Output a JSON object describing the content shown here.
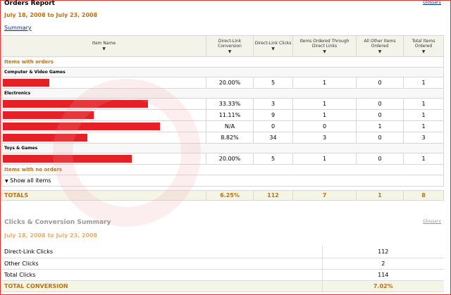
{
  "header": {
    "title": "Orders Report",
    "glossary": "Glossary",
    "date_range": "July 18, 2008 to July 23, 2008",
    "summary_link": "Summary"
  },
  "table": {
    "columns": [
      "Item Name",
      "Direct-Link Conversion",
      "Direct-Link Clicks",
      "Items Ordered Through Direct Links",
      "All Other Items Ordered",
      "Total Items Ordered"
    ],
    "sort_icon": "triangle-down-icon",
    "section_with_orders": "Items with orders",
    "categories": [
      {
        "name": "Computer & Video Games",
        "rows": [
          {
            "bar": 0.23,
            "conversion": "20.00%",
            "clicks": "5",
            "through": "1",
            "other": "0",
            "total": "1"
          }
        ]
      },
      {
        "name": "Electronics",
        "rows": [
          {
            "bar": 0.72,
            "conversion": "33.33%",
            "clicks": "3",
            "through": "1",
            "other": "0",
            "total": "1"
          },
          {
            "bar": 0.45,
            "conversion": "11.11%",
            "clicks": "9",
            "through": "1",
            "other": "0",
            "total": "1"
          },
          {
            "bar": 0.78,
            "conversion": "N/A",
            "clicks": "0",
            "through": "0",
            "other": "1",
            "total": "1"
          },
          {
            "bar": 0.42,
            "conversion": "8.82%",
            "clicks": "34",
            "through": "3",
            "other": "0",
            "total": "3"
          }
        ]
      },
      {
        "name": "Toys & Games",
        "rows": [
          {
            "bar": 0.64,
            "conversion": "20.00%",
            "clicks": "5",
            "through": "1",
            "other": "0",
            "total": "1"
          }
        ]
      }
    ],
    "section_no_orders": "Items with no orders",
    "show_all": "Show all items",
    "totals": {
      "label": "TOTALS",
      "conversion": "6.25%",
      "clicks": "112",
      "through": "7",
      "other": "1",
      "total": "8"
    }
  },
  "summary": {
    "title": "Clicks & Conversion Summary",
    "glossary": "Glossary",
    "date_range": "July 18, 2008 to July 23, 2008",
    "rows": [
      {
        "label": "Direct-Link Clicks",
        "value": "112"
      },
      {
        "label": "Other Clicks",
        "value": "2"
      },
      {
        "label": "Total Clicks",
        "value": "114"
      }
    ],
    "total": {
      "label": "TOTAL CONVERSION",
      "value": "7.02%"
    }
  },
  "colors": {
    "bar": "#e52026",
    "accent": "#c07010",
    "link": "#003399"
  }
}
